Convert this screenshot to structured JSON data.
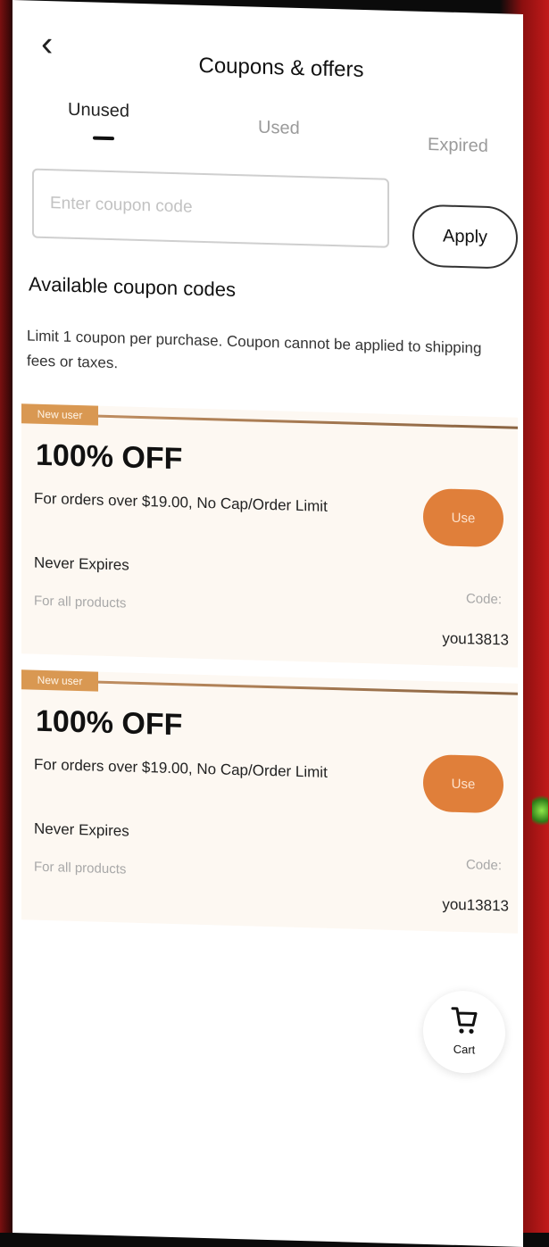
{
  "header": {
    "title": "Coupons & offers",
    "back_icon": "chevron-left-icon"
  },
  "tabs": [
    {
      "label": "Unused",
      "active": true
    },
    {
      "label": "Used",
      "active": false
    },
    {
      "label": "Expired",
      "active": false
    }
  ],
  "code_entry": {
    "placeholder": "Enter coupon code",
    "value": "",
    "apply_label": "Apply"
  },
  "available": {
    "title": "Available coupon codes",
    "note": "Limit 1 coupon per purchase. Coupon cannot be applied to shipping fees or taxes."
  },
  "coupons": [
    {
      "badge": "New user",
      "discount": "100% OFF",
      "condition": "For orders over $19.00, No Cap/Order Limit",
      "use_label": "Use",
      "expiry": "Never Expires",
      "scope": "For all products",
      "code_label": "Code:",
      "code": "you13813"
    },
    {
      "badge": "New user",
      "discount": "100% OFF",
      "condition": "For orders over $19.00, No Cap/Order Limit",
      "use_label": "Use",
      "expiry": "Never Expires",
      "scope": "For all products",
      "code_label": "Code:",
      "code": "you13813"
    }
  ],
  "cart": {
    "label": "Cart",
    "icon": "cart-icon"
  },
  "colors": {
    "accent": "#e07f3a",
    "badge": "#d99852",
    "card_background": "#fdf8f2"
  }
}
